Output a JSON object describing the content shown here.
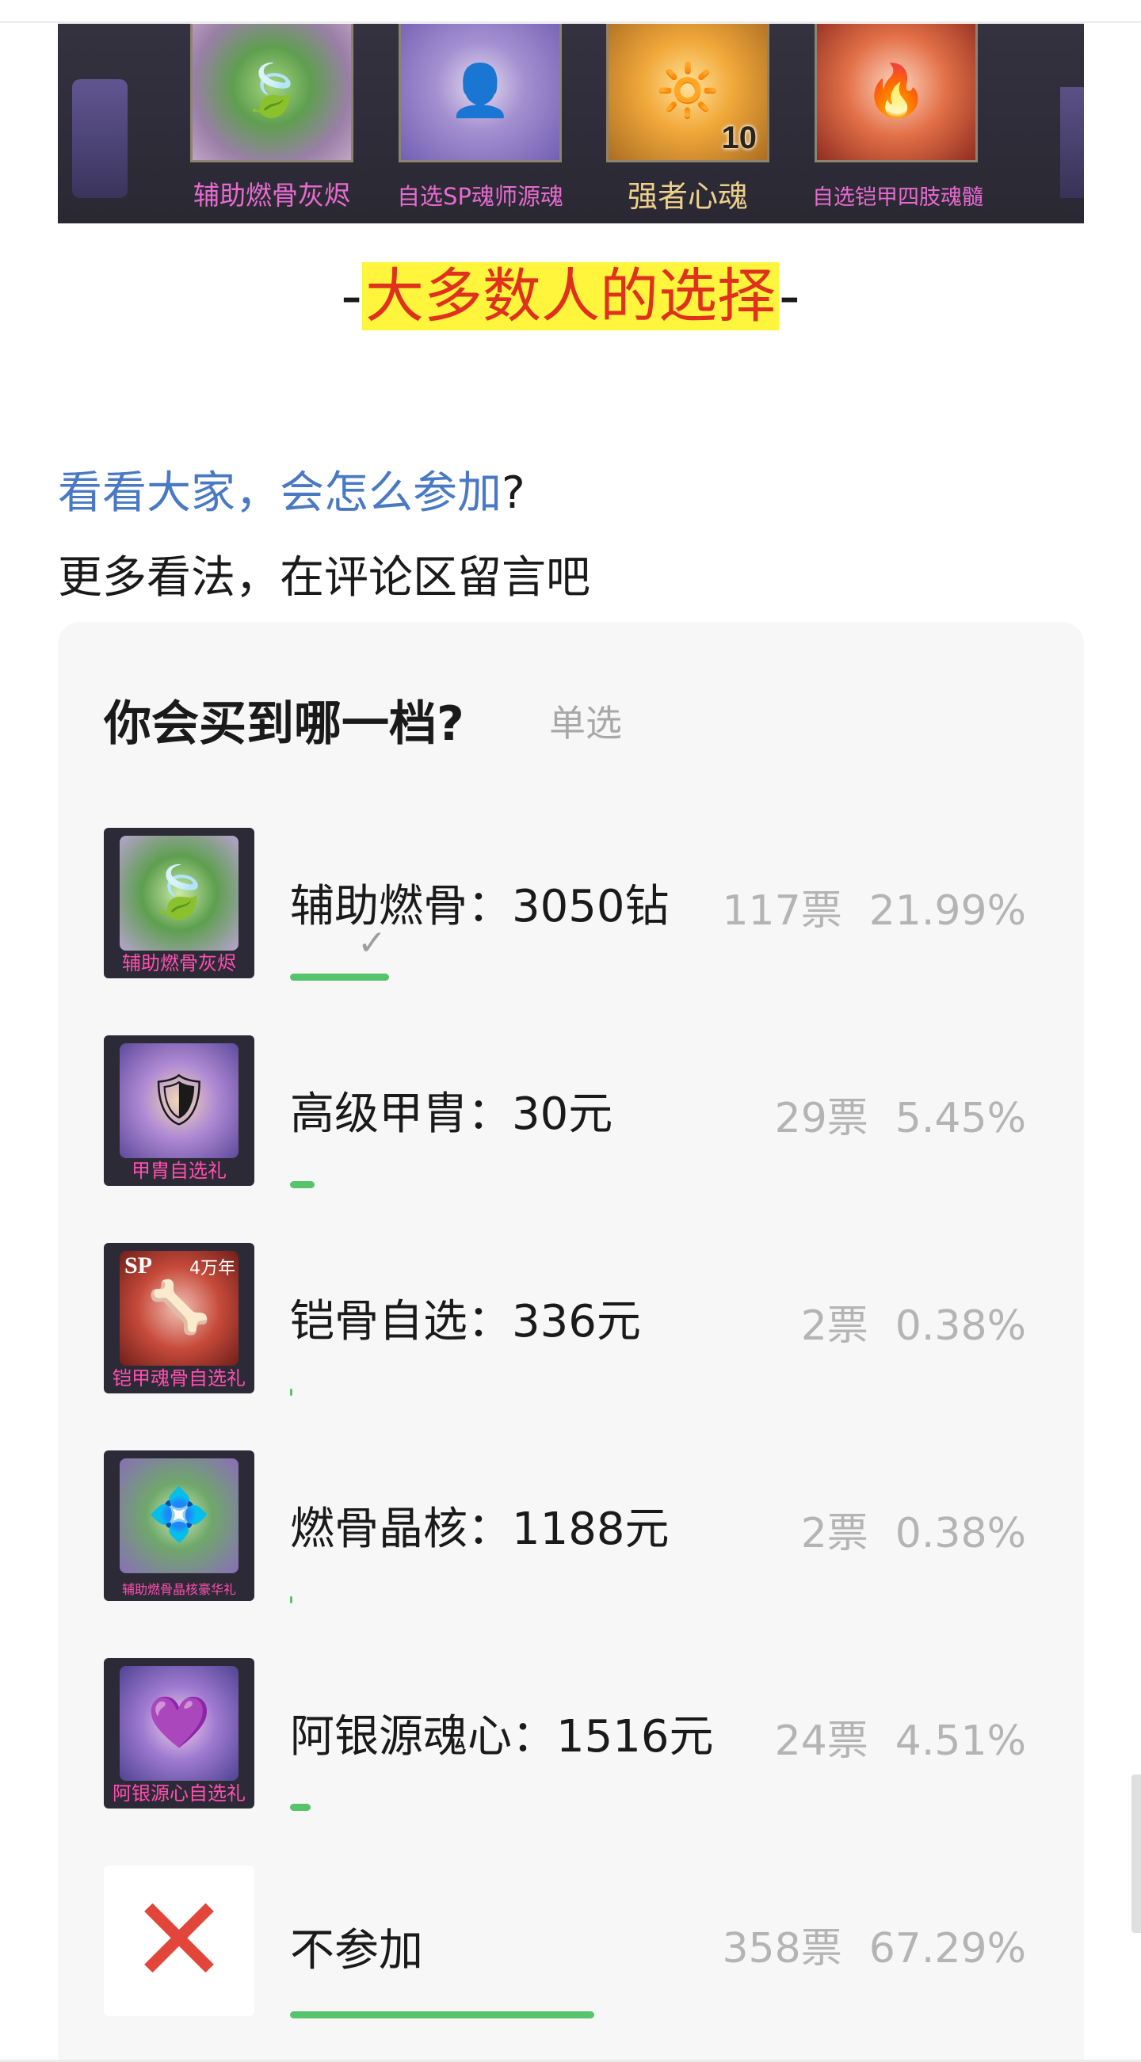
{
  "banner": {
    "items": [
      {
        "label": "辅助燃骨灰烬",
        "icon": "green-leaf-emblem-icon"
      },
      {
        "label": "自选SP魂师源魂",
        "icon": "character-portrait-icon"
      },
      {
        "label": "强者心魂",
        "icon": "golden-orb-icon",
        "qty": "10"
      },
      {
        "label": "自选铠甲四肢魂髓",
        "icon": "red-armor-emblem-icon"
      }
    ]
  },
  "headline": {
    "dash_left": "-",
    "text": "大多数人的选择",
    "dash_right": "-"
  },
  "intro": {
    "line1_link": "看看大家，会怎么参加",
    "line1_tail": "?",
    "line2": "更多看法，在评论区留言吧"
  },
  "poll": {
    "title": "你会买到哪一档?",
    "mode": "单选",
    "options": [
      {
        "label": "辅助燃骨：3050钻",
        "votes": "117票",
        "percent": "21.99%",
        "fraction": 0.2199,
        "selected": true,
        "image_caption": "辅助燃骨灰烬",
        "icon": "green-leaf-emblem-icon"
      },
      {
        "label": "高级甲胄：30元",
        "votes": "29票",
        "percent": "5.45%",
        "fraction": 0.0545,
        "selected": false,
        "image_caption": "甲胄自选礼",
        "icon": "armor-helmet-icon"
      },
      {
        "label": "铠骨自选：336元",
        "votes": "2票",
        "percent": "0.38%",
        "fraction": 0.0038,
        "selected": false,
        "image_caption": "铠甲魂骨自选礼",
        "icon": "sp-armor-bone-icon",
        "badge": "SP",
        "badge_sub": "4万年"
      },
      {
        "label": "燃骨晶核：1188元",
        "votes": "2票",
        "percent": "0.38%",
        "fraction": 0.0038,
        "selected": false,
        "image_caption": "辅助燃骨晶核豪华礼",
        "icon": "crystal-core-icon"
      },
      {
        "label": "阿银源魂心：1516元",
        "votes": "24票",
        "percent": "4.51%",
        "fraction": 0.0451,
        "selected": false,
        "image_caption": "阿银源心自选礼",
        "icon": "heart-portrait-icon"
      },
      {
        "label": "不参加",
        "votes": "358票",
        "percent": "67.29%",
        "fraction": 0.6729,
        "selected": false,
        "image_caption": "",
        "icon": "red-cross-icon"
      }
    ],
    "check_mark": "✓"
  },
  "colors": {
    "link": "#4a79c4",
    "highlight_bg": "#fef53c",
    "highlight_text": "#e0301e",
    "bar": "#57c46c",
    "stats_text": "#b4b4b4",
    "caption_pink": "#ff4fb0"
  }
}
